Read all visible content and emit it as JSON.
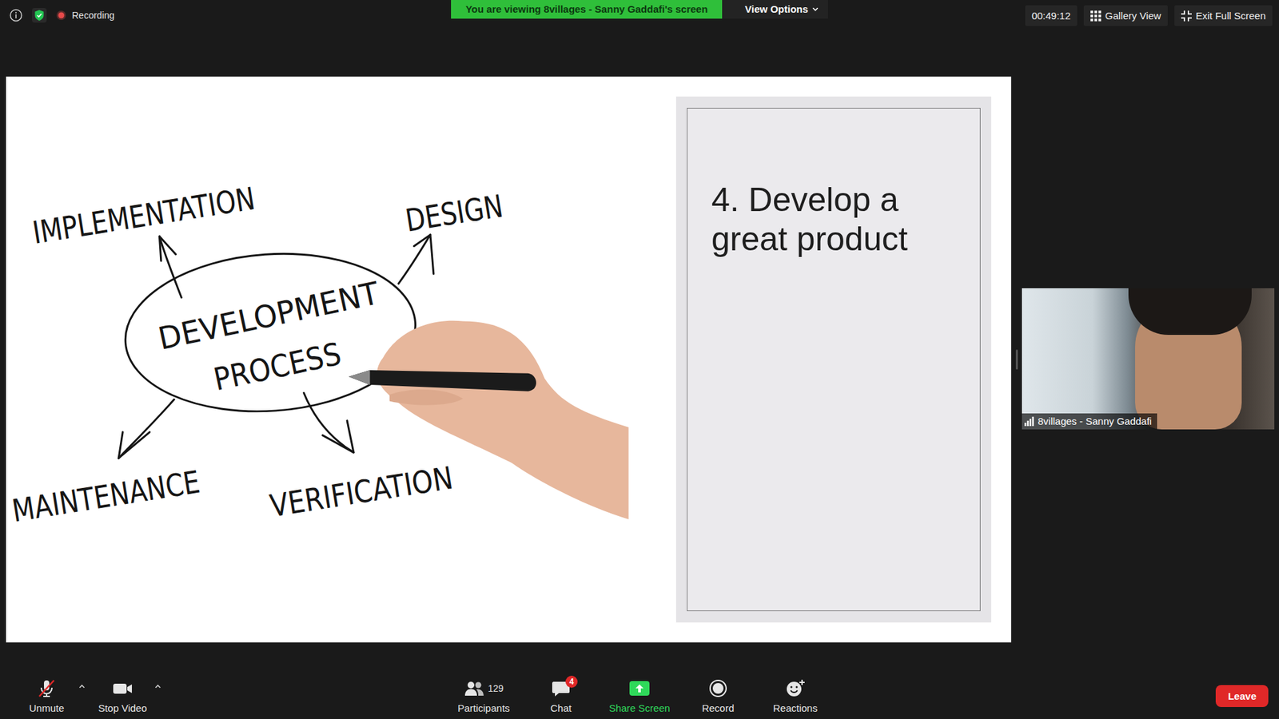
{
  "top_bar": {
    "recording_label": "Recording",
    "viewing_banner": "You are viewing 8villages - Sanny Gaddafi's screen",
    "view_options": "View Options",
    "timer": "00:49:12",
    "gallery_view": "Gallery View",
    "exit_full_screen": "Exit Full Screen"
  },
  "slide": {
    "diagram": {
      "center": [
        "DEVELOPMENT",
        "PROCESS"
      ],
      "labels": [
        "IMPLEMENTATION",
        "DESIGN",
        "MAINTENANCE",
        "VERIFICATION"
      ]
    },
    "title": "4. Develop a great product"
  },
  "video": {
    "name": "8villages - Sanny Gaddafi"
  },
  "toolbar": {
    "left": [
      {
        "label": "Unmute",
        "kind": "mic",
        "muted": true
      },
      {
        "label": "Stop Video",
        "kind": "camera",
        "muted": false
      }
    ],
    "center": [
      {
        "label": "Participants",
        "kind": "participants",
        "count": "129",
        "color": "#e6e6e6"
      },
      {
        "label": "Chat",
        "kind": "chat",
        "badge": "4",
        "color": "#e6e6e6"
      },
      {
        "label": "Share Screen",
        "kind": "share",
        "color": "#2fd95a"
      },
      {
        "label": "Record",
        "kind": "record",
        "color": "#e6e6e6"
      },
      {
        "label": "Reactions",
        "kind": "reactions",
        "color": "#e6e6e6"
      }
    ],
    "leave": "Leave"
  }
}
